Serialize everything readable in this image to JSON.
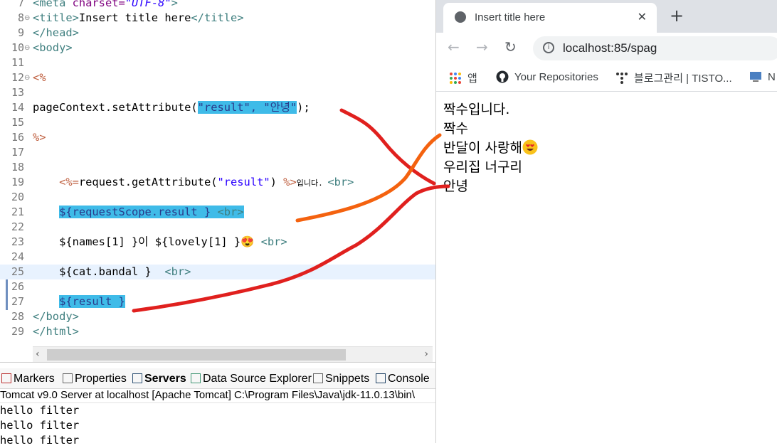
{
  "editor": {
    "lines": [
      {
        "n": "7",
        "fold": false
      },
      {
        "n": "8",
        "fold": true
      },
      {
        "n": "9",
        "fold": false
      },
      {
        "n": "10",
        "fold": true
      },
      {
        "n": "11",
        "fold": false
      },
      {
        "n": "12",
        "fold": true
      },
      {
        "n": "13",
        "fold": false
      },
      {
        "n": "14",
        "fold": false
      },
      {
        "n": "15",
        "fold": false
      },
      {
        "n": "16",
        "fold": false
      },
      {
        "n": "17",
        "fold": false
      },
      {
        "n": "18",
        "fold": false
      },
      {
        "n": "19",
        "fold": false
      },
      {
        "n": "20",
        "fold": false
      },
      {
        "n": "21",
        "fold": false
      },
      {
        "n": "22",
        "fold": false
      },
      {
        "n": "23",
        "fold": false
      },
      {
        "n": "24",
        "fold": false
      },
      {
        "n": "25",
        "fold": false
      },
      {
        "n": "26",
        "fold": false
      },
      {
        "n": "27",
        "fold": false
      },
      {
        "n": "28",
        "fold": false
      },
      {
        "n": "29",
        "fold": false
      }
    ],
    "code": {
      "l7_open": "<meta",
      "l7_attr": " charset=",
      "l7_str": "\"UTF-8\"",
      "l7_close": ">",
      "l8_open": "<title>",
      "l8_text": "Insert title here",
      "l8_close": "</title>",
      "l9": "</head>",
      "l10": "<body>",
      "l12": "<%",
      "l14_call": "pageContext.setAttribute(",
      "l14_args": "\"result\", \"안녕\"",
      "l14_end": ");",
      "l16": "%>",
      "l19_indent": "    ",
      "l19_open": "<%=",
      "l19_expr": "request.getAttribute(",
      "l19_str": "\"result\"",
      "l19_paren": ") ",
      "l19_close": "%>",
      "l19_text": "입니다. ",
      "l19_br": "<br>",
      "l21_indent": "    ",
      "l21_el": "${requestScope.result }",
      "l21_br": " <br>",
      "l23_indent": "    ",
      "l23_text": "${names[1] }이 ${lovely[1] }😍 ",
      "l23_br": "<br>",
      "l25_indent": "    ",
      "l25_text": "${cat.bandal }  ",
      "l25_br": "<br>",
      "l27_indent": "    ",
      "l27_el": "${result }",
      "l28": "</body>",
      "l29": "</html>"
    }
  },
  "panel": {
    "tabs": [
      {
        "label": "Markers",
        "active": false
      },
      {
        "label": "Properties",
        "active": false
      },
      {
        "label": "Servers",
        "active": true
      },
      {
        "label": "Data Source Explorer",
        "active": false
      },
      {
        "label": "Snippets",
        "active": false
      },
      {
        "label": "Console",
        "active": false
      }
    ],
    "server_line": "Tomcat v9.0 Server at localhost [Apache Tomcat] C:\\Program Files\\Java\\jdk-11.0.13\\bin\\",
    "console_lines": [
      "hello filter",
      "hello filter",
      "hello filter"
    ]
  },
  "browser": {
    "tab_title": "Insert title here",
    "tab_close": "✕",
    "new_tab": "+",
    "url": "localhost:85/spag",
    "bookmarks": [
      {
        "label": "앱",
        "icon": "apps-grid-icon"
      },
      {
        "label": "Your Repositories",
        "icon": "github-icon"
      },
      {
        "label": "블로그관리 | TISTO...",
        "icon": "tistory-icon"
      },
      {
        "label": "N",
        "icon": "monitor-icon"
      }
    ],
    "content_lines": [
      {
        "text": "짝수입니다.",
        "emoji": false
      },
      {
        "text": "짝수",
        "emoji": false
      },
      {
        "text": "반달이 사랑해",
        "emoji": true
      },
      {
        "text": "우리집 너구리",
        "emoji": false
      },
      {
        "text": "안녕",
        "emoji": false
      }
    ]
  },
  "colors": {
    "highlight": "#3fbbe8",
    "red_ink": "#e0201e",
    "orange_ink": "#f4620f"
  }
}
